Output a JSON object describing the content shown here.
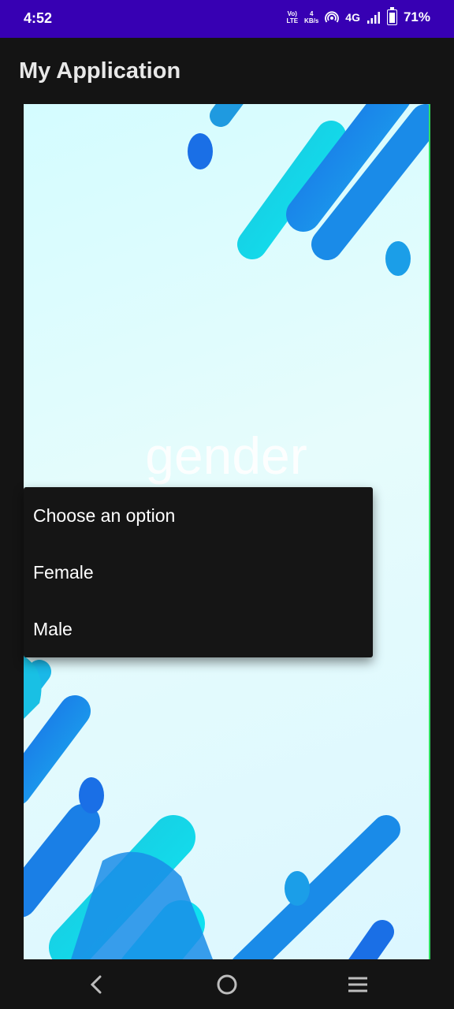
{
  "status_bar": {
    "time": "4:52",
    "volte_top": "Vo)",
    "volte_bottom": "LTE",
    "speed_value": "4",
    "speed_unit": "KB/s",
    "network": "4G",
    "battery": "71%"
  },
  "app_bar": {
    "title": "My Application"
  },
  "content": {
    "heading": "gender"
  },
  "dropdown": {
    "options": [
      "Choose an option",
      "Female",
      "Male"
    ]
  },
  "nav_bar": {
    "icons": [
      "back-icon",
      "home-icon",
      "recents-icon"
    ]
  },
  "colors": {
    "status_bar": "#3700b3",
    "background": "#141414",
    "accent_blue": "#1e7be8",
    "accent_cyan": "#16d8e8"
  }
}
